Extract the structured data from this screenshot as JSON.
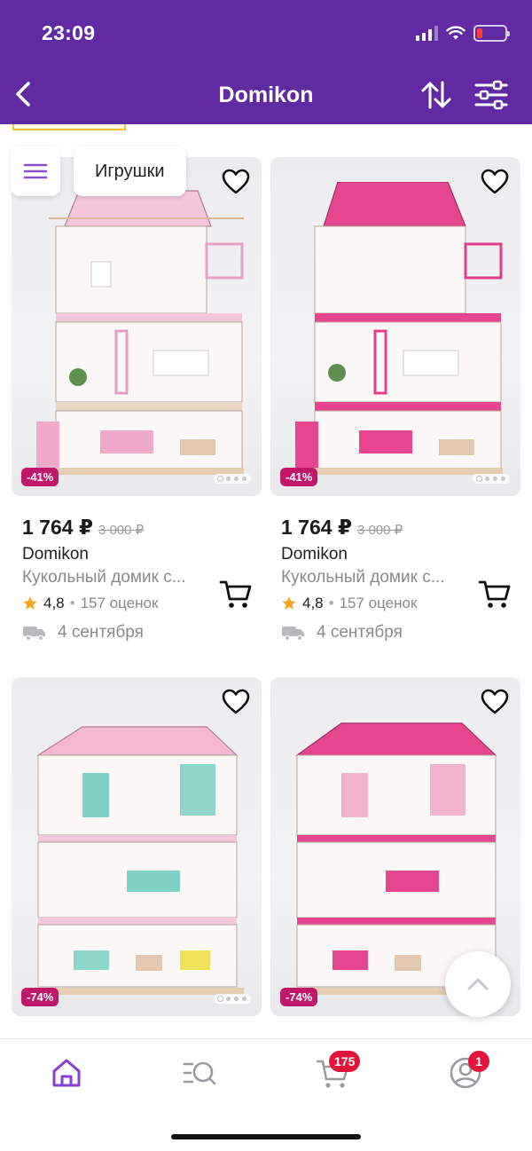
{
  "status_bar": {
    "time": "23:09"
  },
  "header": {
    "title": "Domikon",
    "back_icon": "chevron-left-icon",
    "sort_icon": "sort-arrows-icon",
    "filter_icon": "sliders-icon"
  },
  "colors": {
    "brand": "#5f2aa2",
    "discount": "#c0176b",
    "badge": "#e3143b",
    "star": "#f5a623"
  },
  "category": {
    "label": "Игрушки",
    "menu_icon": "hamburger-icon"
  },
  "products": [
    {
      "discount": "-41%",
      "price": "1 764 ₽",
      "old_price": "3 000 ₽",
      "brand": "Domikon",
      "title": "Кукольный домик с...",
      "rating": "4,8",
      "reviews": "157 оценок",
      "delivery": "4 сентября",
      "roof_color": "light-pink"
    },
    {
      "discount": "-41%",
      "price": "1 764 ₽",
      "old_price": "3 000 ₽",
      "brand": "Domikon",
      "title": "Кукольный домик с...",
      "rating": "4,8",
      "reviews": "157 оценок",
      "delivery": "4 сентября",
      "roof_color": "hot-pink"
    },
    {
      "discount": "-74%",
      "roof_color": "light-pink"
    },
    {
      "discount": "-74%",
      "roof_color": "hot-pink"
    }
  ],
  "tabbar": {
    "cart_badge": "175",
    "profile_badge": "1"
  }
}
